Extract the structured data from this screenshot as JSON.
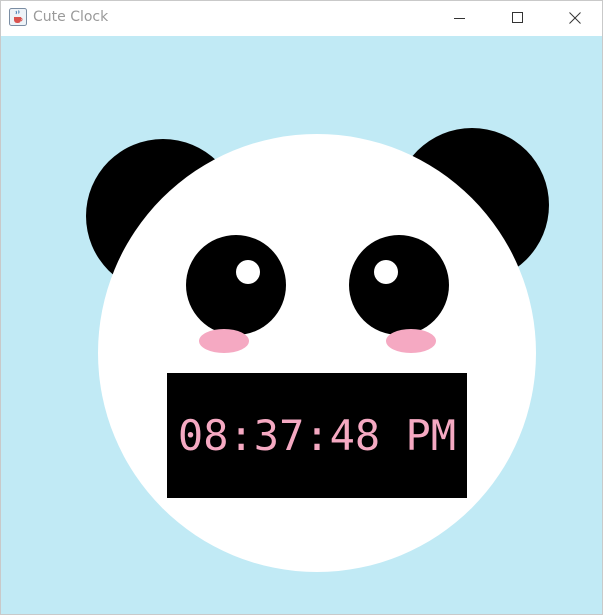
{
  "window": {
    "title": "Cute Clock",
    "app_icon": "java-cup-icon",
    "controls": [
      "minimize-icon",
      "maximize-icon",
      "close-icon"
    ]
  },
  "clock": {
    "time": "08:37:48 PM"
  },
  "panda": {
    "features": [
      "left-ear",
      "right-ear",
      "face",
      "left-eye",
      "right-eye",
      "left-cheek",
      "right-cheek"
    ]
  },
  "colors": {
    "background": "#c1eaf5",
    "face": "#ffffff",
    "ears_eyes": "#000000",
    "cheeks": "#f5a9c2",
    "clock_text": "#f5a9c2",
    "clock_bg": "#000000"
  }
}
